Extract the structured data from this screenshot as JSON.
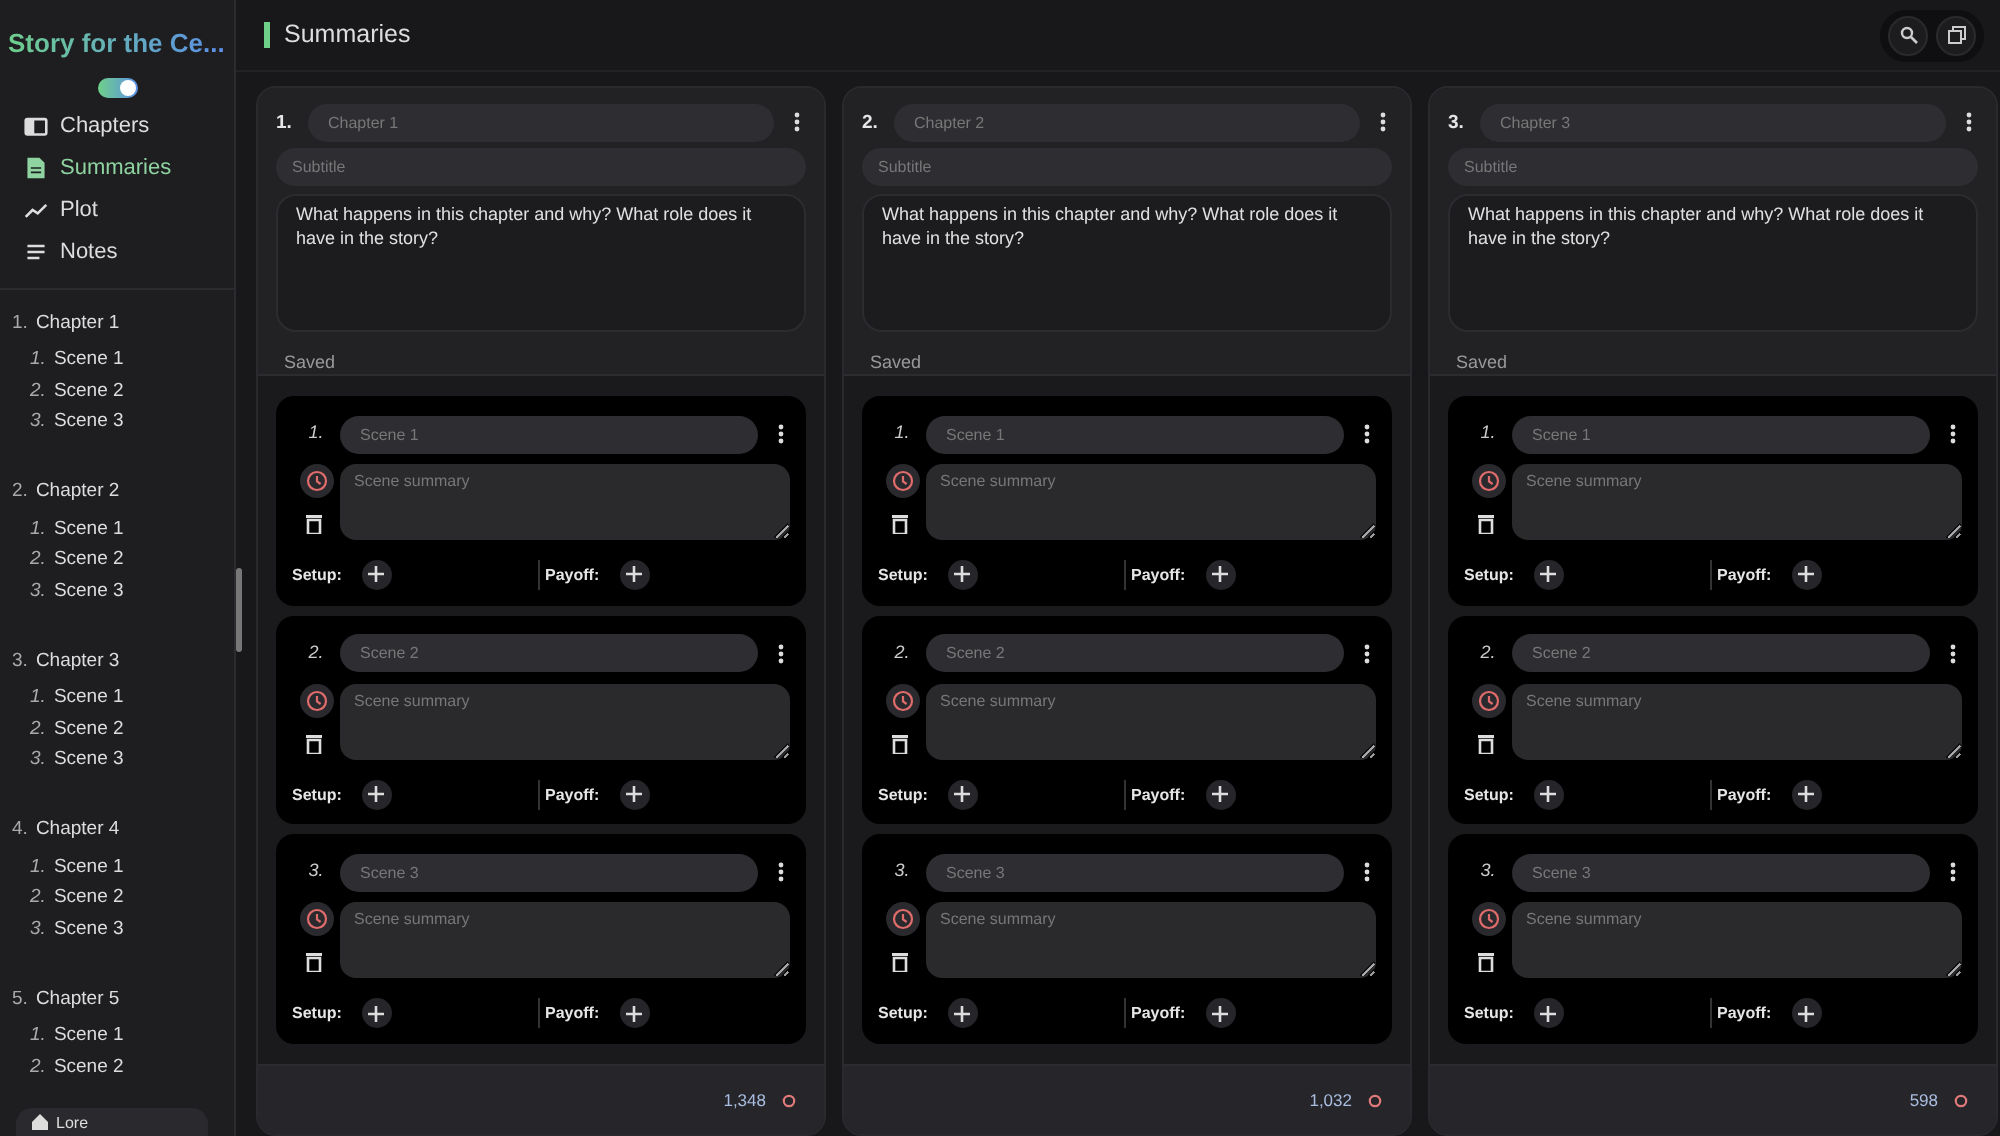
{
  "app": {
    "title": "Story for the Ce...",
    "theme_toggle": {
      "on": true
    }
  },
  "nav": [
    {
      "label": "Chapters",
      "selected": false
    },
    {
      "label": "Summaries",
      "selected": true
    },
    {
      "label": "Plot",
      "selected": false
    },
    {
      "label": "Notes",
      "selected": false
    }
  ],
  "outline": [
    {
      "number": "1.",
      "label": "Chapter 1",
      "children": [
        {
          "number": "1.",
          "label": "Scene 1"
        },
        {
          "number": "2.",
          "label": "Scene 2"
        },
        {
          "number": "3.",
          "label": "Scene 3"
        }
      ]
    },
    {
      "number": "2.",
      "label": "Chapter 2",
      "children": [
        {
          "number": "1.",
          "label": "Scene 1"
        },
        {
          "number": "2.",
          "label": "Scene 2"
        },
        {
          "number": "3.",
          "label": "Scene 3"
        }
      ]
    },
    {
      "number": "3.",
      "label": "Chapter 3",
      "children": [
        {
          "number": "1.",
          "label": "Scene 1"
        },
        {
          "number": "2.",
          "label": "Scene 2"
        },
        {
          "number": "3.",
          "label": "Scene 3"
        }
      ]
    },
    {
      "number": "4.",
      "label": "Chapter 4",
      "children": [
        {
          "number": "1.",
          "label": "Scene 1"
        },
        {
          "number": "2.",
          "label": "Scene 2"
        },
        {
          "number": "3.",
          "label": "Scene 3"
        }
      ]
    },
    {
      "number": "5.",
      "label": "Chapter 5",
      "children": [
        {
          "number": "1.",
          "label": "Scene 1"
        },
        {
          "number": "2.",
          "label": "Scene 2"
        }
      ]
    }
  ],
  "lore_button": "Lore",
  "page_title": "Summaries",
  "chapters": [
    {
      "number": "1.",
      "title_placeholder": "Chapter 1",
      "subtitle_placeholder": "Subtitle",
      "summary": "What happens in this chapter and why? What role does it have in the story?",
      "status": "Saved",
      "scenes": [
        {
          "number": "1.",
          "title_placeholder": "Scene 1",
          "summary_placeholder": "Scene summary",
          "setup_label": "Setup:",
          "payoff_label": "Payoff:"
        },
        {
          "number": "2.",
          "title_placeholder": "Scene 2",
          "summary_placeholder": "Scene summary",
          "setup_label": "Setup:",
          "payoff_label": "Payoff:"
        },
        {
          "number": "3.",
          "title_placeholder": "Scene 3",
          "summary_placeholder": "Scene summary",
          "setup_label": "Setup:",
          "payoff_label": "Payoff:"
        }
      ],
      "word_count": "1,348"
    },
    {
      "number": "2.",
      "title_placeholder": "Chapter 2",
      "subtitle_placeholder": "Subtitle",
      "summary": "What happens in this chapter and why? What role does it have in the story?",
      "status": "Saved",
      "scenes": [
        {
          "number": "1.",
          "title_placeholder": "Scene 1",
          "summary_placeholder": "Scene summary",
          "setup_label": "Setup:",
          "payoff_label": "Payoff:"
        },
        {
          "number": "2.",
          "title_placeholder": "Scene 2",
          "summary_placeholder": "Scene summary",
          "setup_label": "Setup:",
          "payoff_label": "Payoff:"
        },
        {
          "number": "3.",
          "title_placeholder": "Scene 3",
          "summary_placeholder": "Scene summary",
          "setup_label": "Setup:",
          "payoff_label": "Payoff:"
        }
      ],
      "word_count": "1,032"
    },
    {
      "number": "3.",
      "title_placeholder": "Chapter 3",
      "subtitle_placeholder": "Subtitle",
      "summary": "What happens in this chapter and why? What role does it have in the story?",
      "status": "Saved",
      "scenes": [
        {
          "number": "1.",
          "title_placeholder": "Scene 1",
          "summary_placeholder": "Scene summary",
          "setup_label": "Setup:",
          "payoff_label": "Payoff:"
        },
        {
          "number": "2.",
          "title_placeholder": "Scene 2",
          "summary_placeholder": "Scene summary",
          "setup_label": "Setup:",
          "payoff_label": "Payoff:"
        },
        {
          "number": "3.",
          "title_placeholder": "Scene 3",
          "summary_placeholder": "Scene summary",
          "setup_label": "Setup:",
          "payoff_label": "Payoff:"
        }
      ],
      "word_count": "598"
    }
  ]
}
